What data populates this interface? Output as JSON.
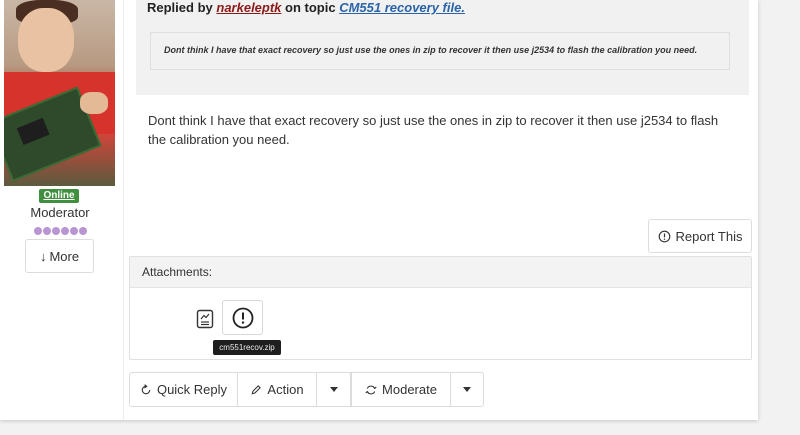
{
  "user": {
    "status_badge": "Online",
    "role": "Moderator",
    "rank_dots": 6,
    "more_label": "More",
    "more_arrow": "↓"
  },
  "quote": {
    "prefix": "Replied by",
    "username": "narkeleptk",
    "middle": "on topic",
    "topic": "CM551 recovery file.",
    "text": "Dont think I have that exact recovery so just use the ones in zip to recover it then use j2534 to flash the calibration you need."
  },
  "post": {
    "body": "Dont think I have that exact recovery so just use the ones in zip to recover it then use j2534 to flash the calibration you need."
  },
  "report": {
    "label": "Report This",
    "icon": "alert-circle-icon"
  },
  "attachments": {
    "header": "Attachments:",
    "file_icon": "document-chart-icon",
    "info_icon": "exclamation-circle-icon",
    "tooltip": "cm551recov.zip"
  },
  "actions": {
    "quick_reply": "Quick Reply",
    "action": "Action",
    "moderate": "Moderate"
  },
  "colors": {
    "online_badge": "#3f8f3f",
    "username": "#8b1a1a",
    "topic_link": "#2b63a8",
    "rank_dot": "#b995d2"
  }
}
